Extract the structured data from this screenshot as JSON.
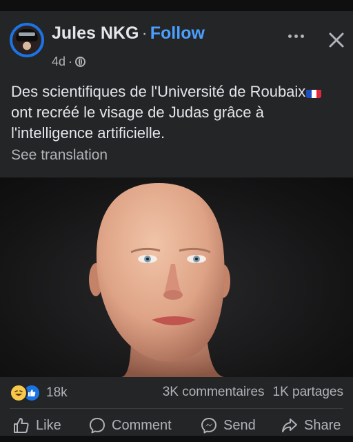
{
  "post": {
    "author": "Jules NKG",
    "separator": "·",
    "follow_label": "Follow",
    "time": "4d",
    "time_separator": "·",
    "text_part1": "Des scientifiques de l'Université de Roubaix",
    "text_part2": "ont recréé le visage de Judas grâce à l'intelligence artificielle.",
    "see_translation": "See translation"
  },
  "stats": {
    "reactions_count": "18k",
    "comments": "3K commentaires",
    "shares": "1K partages"
  },
  "actions": {
    "like": "Like",
    "comment": "Comment",
    "send": "Send",
    "share": "Share"
  },
  "icons": {
    "privacy": "globe-icon",
    "more": "more-options-icon",
    "close": "close-icon",
    "reaction_1": "haha-reaction-icon",
    "reaction_2": "like-reaction-icon",
    "flag": "france-flag-icon"
  },
  "colors": {
    "background": "#242526",
    "text": "#e4e6eb",
    "secondary_text": "#b0b3b8",
    "follow": "#4a9fff",
    "like_blue": "#1b74e4"
  }
}
